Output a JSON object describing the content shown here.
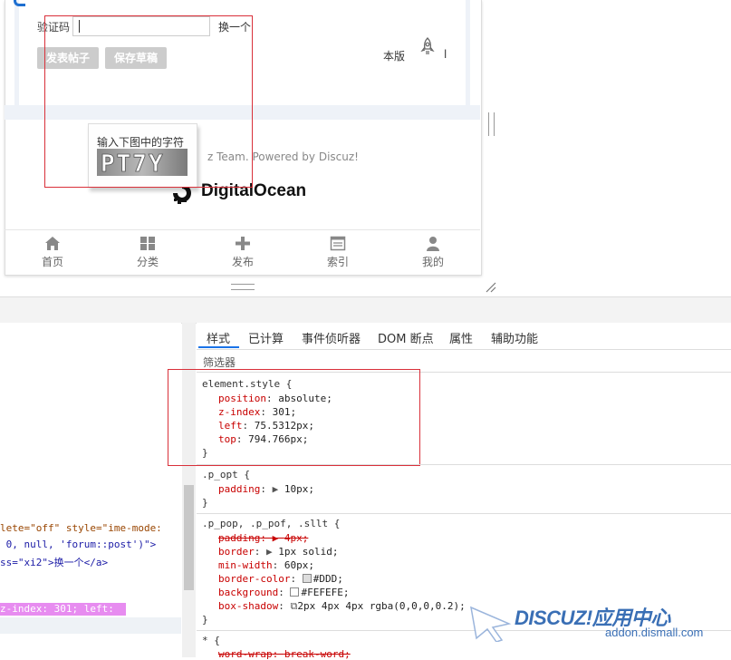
{
  "form": {
    "captcha_label": "验证码",
    "captcha_value": "",
    "change_label": "换一个",
    "post_button": "发表帖子",
    "draft_button": "保存草稿",
    "forum_rules": "本版",
    "forum_rules_tail": "l"
  },
  "footer": {
    "powered_by": "z Team. Powered by Discuz!",
    "sponsor": "DigitalOcean"
  },
  "tabbar": [
    {
      "label": "首页",
      "icon": "home-icon"
    },
    {
      "label": "分类",
      "icon": "grid-icon"
    },
    {
      "label": "发布",
      "icon": "plus-icon"
    },
    {
      "label": "索引",
      "icon": "list-icon"
    },
    {
      "label": "我的",
      "icon": "user-icon"
    }
  ],
  "popup": {
    "title": "输入下图中的字符",
    "captcha_text": "PT7Y"
  },
  "devtools": {
    "tabs": [
      "样式",
      "已计算",
      "事件侦听器",
      "DOM 断点",
      "属性",
      "辅助功能"
    ],
    "active_tab": "样式",
    "filter_placeholder": "筛选器",
    "dom_lines": [
      "lete=\"off\" style=\"ime-mode:",
      " 0, null, 'forum::post')\">",
      "ss=\"xi2\">换一个</a>"
    ],
    "dom_highlight": "z-index: 301; left:",
    "rules": {
      "r1": {
        "selector": "element.style {",
        "decls": [
          {
            "p": "position",
            "v": "absolute;"
          },
          {
            "p": "z-index",
            "v": "301;"
          },
          {
            "p": "left",
            "v": "75.5312px;"
          },
          {
            "p": "top",
            "v": "794.766px;"
          }
        ]
      },
      "r2": {
        "selector": ".p_opt {",
        "p": "padding",
        "v": "10px;"
      },
      "r3": {
        "selector": ".p_pop, .p_pof, .sllt {",
        "decls": [
          {
            "p": "padding",
            "v": "4px;"
          },
          {
            "p": "border",
            "v": "1px solid;"
          },
          {
            "p": "min-width",
            "v": "60px;"
          },
          {
            "p": "border-color",
            "v": "#DDD;"
          },
          {
            "p": "background",
            "v": "#FEFEFE;"
          },
          {
            "p": "box-shadow",
            "v": "2px 4px 4px rgba(0,0,0,0.2);"
          }
        ]
      },
      "r4": {
        "selector": "* {",
        "p": "word-wrap",
        "v": "break-word;"
      },
      "close": "}"
    }
  },
  "watermark": {
    "title": "DISCUZ!应用中心",
    "url": "addon.dismall.com"
  },
  "colors": {
    "accent": "#1a73e8",
    "annotation_red": "#d9303a",
    "highlight_pink": "#e78cf0",
    "watermark_blue": "#3a6fb5"
  }
}
